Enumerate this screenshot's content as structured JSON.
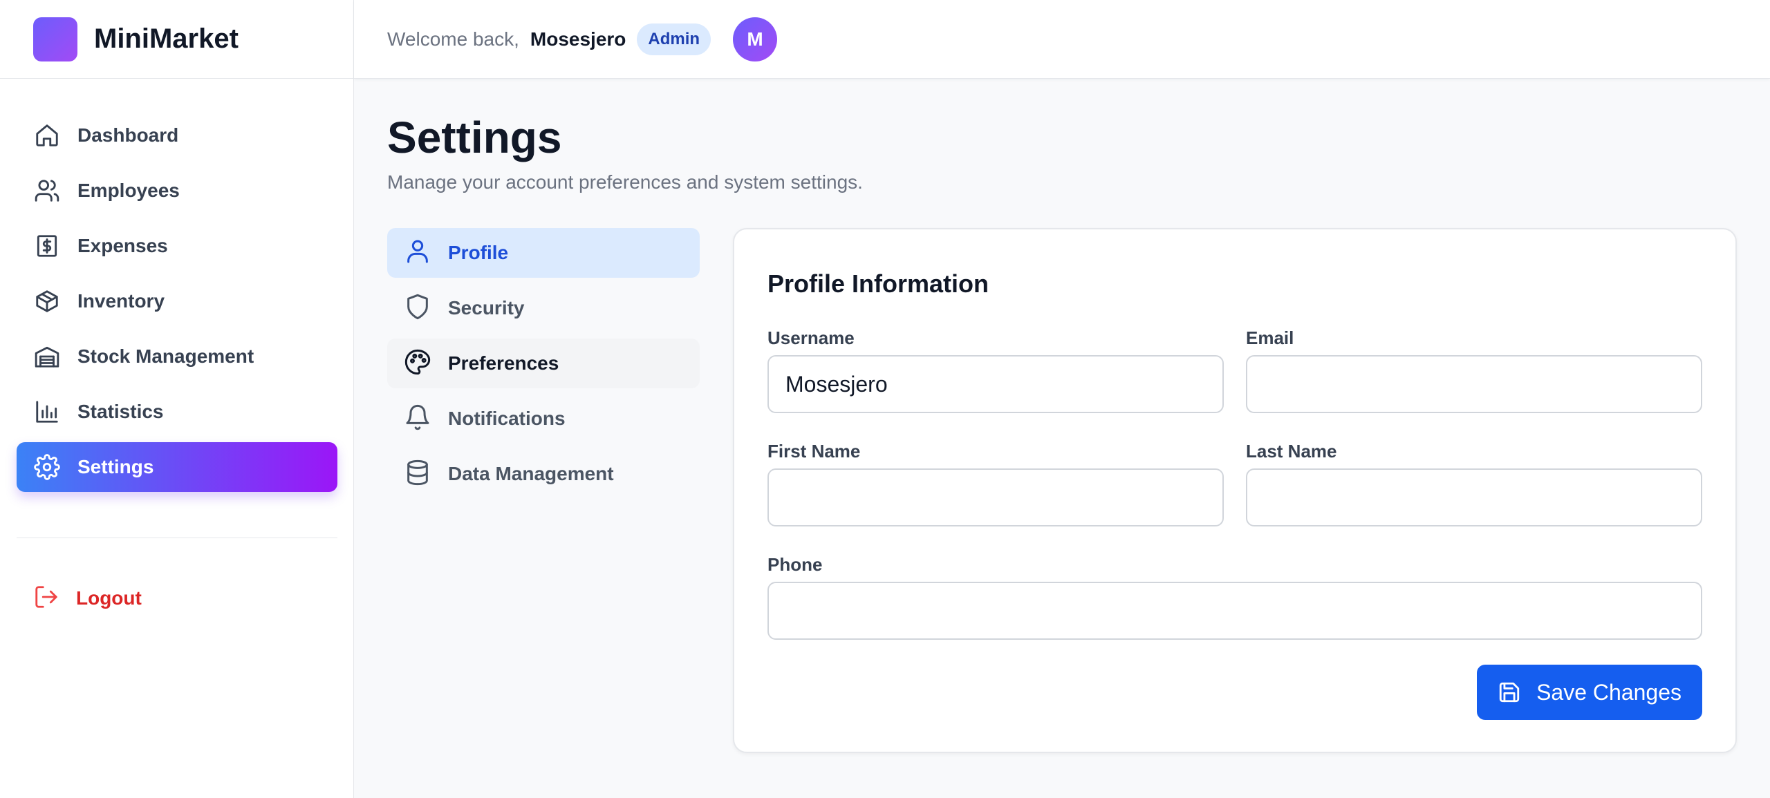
{
  "app": {
    "name": "MiniMarket"
  },
  "sidebar": {
    "items": [
      {
        "label": "Dashboard",
        "icon": "home-icon"
      },
      {
        "label": "Employees",
        "icon": "users-icon"
      },
      {
        "label": "Expenses",
        "icon": "dollar-receipt-icon"
      },
      {
        "label": "Inventory",
        "icon": "box-icon"
      },
      {
        "label": "Stock Management",
        "icon": "warehouse-icon"
      },
      {
        "label": "Statistics",
        "icon": "bar-chart-icon"
      },
      {
        "label": "Settings",
        "icon": "gear-icon",
        "active": true
      }
    ],
    "logout_label": "Logout"
  },
  "header": {
    "welcome": "Welcome back,",
    "username": "Mosesjero",
    "role": "Admin",
    "avatar_initial": "M"
  },
  "page": {
    "title": "Settings",
    "subtitle": "Manage your account preferences and system settings."
  },
  "settings_nav": [
    {
      "label": "Profile",
      "icon": "user-icon",
      "active": true
    },
    {
      "label": "Security",
      "icon": "shield-icon"
    },
    {
      "label": "Preferences",
      "icon": "palette-icon"
    },
    {
      "label": "Notifications",
      "icon": "bell-icon"
    },
    {
      "label": "Data Management",
      "icon": "database-icon"
    }
  ],
  "profile": {
    "title": "Profile Information",
    "username_label": "Username",
    "username_value": "Mosesjero",
    "email_label": "Email",
    "email_value": "",
    "first_name_label": "First Name",
    "first_name_value": "",
    "last_name_label": "Last Name",
    "last_name_value": "",
    "phone_label": "Phone",
    "phone_value": "",
    "save_label": "Save Changes"
  },
  "colors": {
    "accent_gradient_start": "#3b82f6",
    "accent_gradient_end": "#9b16f7",
    "primary_button": "#155eef",
    "logout": "#dc2626",
    "badge_bg": "#dbeafe"
  }
}
